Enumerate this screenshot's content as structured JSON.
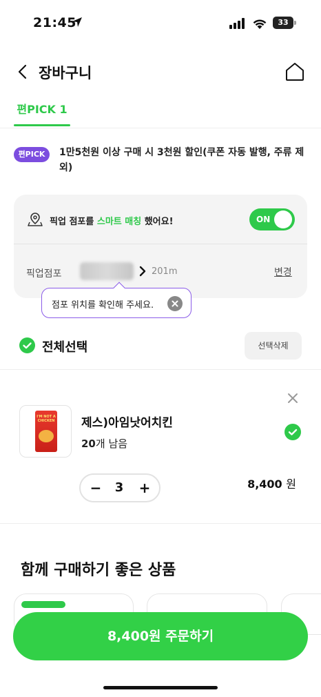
{
  "status_bar": {
    "time": "21:45",
    "battery": "33",
    "icons": [
      "location-arrow-icon",
      "signal-icon",
      "wifi-icon",
      "battery-icon"
    ]
  },
  "header": {
    "title": "장바구니",
    "back_icon": "chevron-left-icon",
    "home_icon": "home-icon"
  },
  "tabs": [
    {
      "label": "편PICK 1",
      "active": true
    }
  ],
  "promo": {
    "badge": "편PICK",
    "text": "1만5천원 이상 구매 시 3천원 할인(쿠폰 자동 발행, 주류 제외)"
  },
  "pickup": {
    "message_prefix": "픽업 점포를 ",
    "message_highlight": "스마트 매칭",
    "message_suffix": " 했어요!",
    "toggle_label": "ON",
    "toggle_on": true,
    "store_label": "픽업점포",
    "distance": "201m",
    "change_label": "변경"
  },
  "tooltip": {
    "text": "점포 위치를 확인해 주세요."
  },
  "select_all": {
    "label": "전체선택",
    "delete_label": "선택삭제"
  },
  "cart_items": [
    {
      "name": "제스)아임낫어치킨",
      "stock_count": "20",
      "stock_suffix": "개 남음",
      "quantity": "3",
      "price": "8,400",
      "currency": "원",
      "selected": true,
      "thumb_text": "I'M NOT A CHICKEN"
    }
  ],
  "recommend": {
    "title": "함께 구매하기 좋은 상품"
  },
  "order_button": {
    "label": "8,400원 주문하기"
  },
  "colors": {
    "accent_green": "#2ec94a",
    "order_green": "#32d047",
    "badge_purple": "#7c4ddf",
    "tooltip_border": "#8a5be8"
  }
}
